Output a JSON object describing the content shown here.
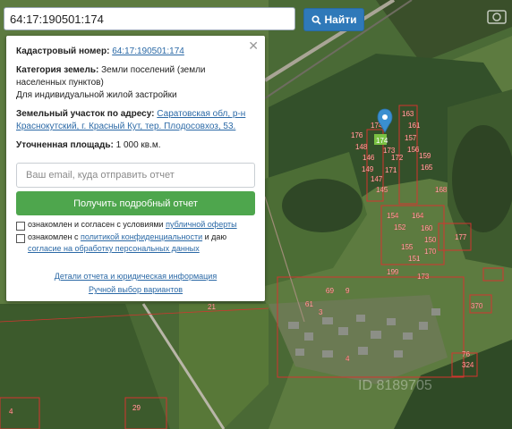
{
  "search": {
    "value": "64:17:190501:174",
    "button_label": "Найти"
  },
  "card": {
    "cadastral_label": "Кадастровый номер:",
    "cadastral_value": "64:17:190501:174",
    "category_label": "Категория земель:",
    "category_value": "Земли поселений (земли населенных пунктов)",
    "usage": "Для индивидуальной жилой застройки",
    "address_label": "Земельный участок по адресу:",
    "address_value": "Саратовская обл, р-н Краснокутский, г. Красный Кут, тер. Плодосовхоз, 53.",
    "area_label": "Уточненная площадь:",
    "area_value": "1 000 кв.м.",
    "email_placeholder": "Ваш email, куда отправить отчет",
    "report_button": "Получить подробный отчет",
    "consent1_text": "ознакомлен и согласен с условиями",
    "consent1_link": "публичной оферты",
    "consent2_text": "ознакомлен с",
    "consent2_link1": "политикой конфиденциальности",
    "consent2_and": "и даю",
    "consent2_link2": "согласие на обработку персональных данных",
    "footer_link1": "Детали отчета и юридическая информация",
    "footer_link2": "Ручной выбор вариантов"
  },
  "map": {
    "parcel_numbers": [
      "163",
      "174",
      "161",
      "176",
      "157",
      "148",
      "173",
      "156",
      "146",
      "149",
      "171",
      "159",
      "147",
      "172",
      "165",
      "145",
      "168",
      "154",
      "164",
      "152",
      "160",
      "177",
      "155",
      "150",
      "151",
      "199",
      "170",
      "173",
      "69",
      "61",
      "9",
      "370",
      "76",
      "324",
      "21",
      "29",
      "4",
      "3",
      "4"
    ],
    "highlighted_parcel": "174",
    "watermark": "ID 8189705",
    "colors": {
      "field": "#5b7a3c",
      "forest": "#2f4a26",
      "parcel_outline": "#d3342f",
      "pin": "#3a8fd0"
    }
  }
}
